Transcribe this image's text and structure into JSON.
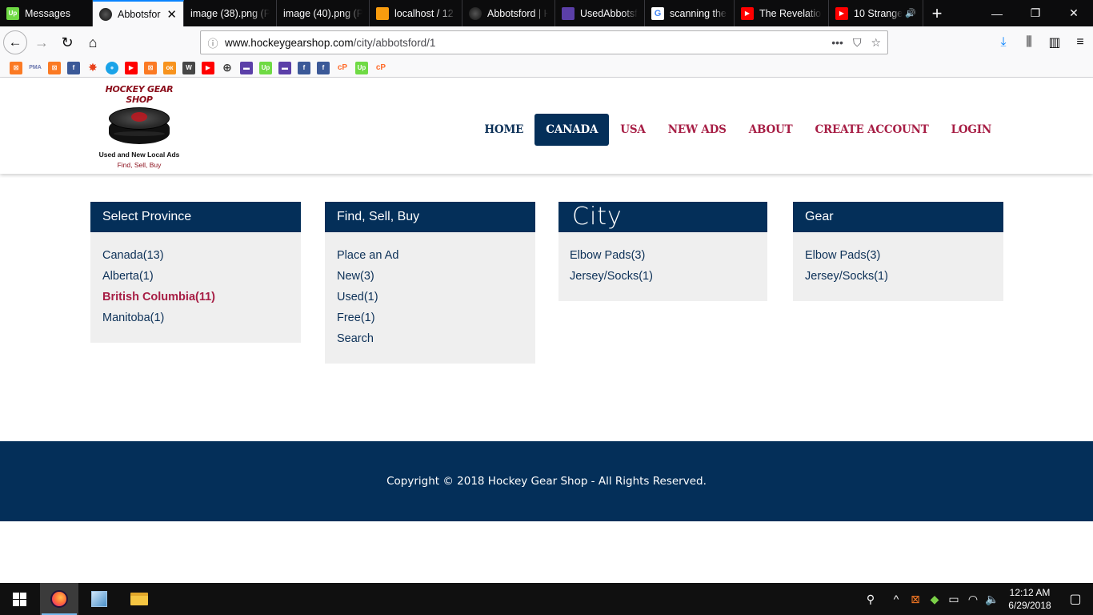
{
  "browser": {
    "tabs": [
      {
        "title": "Messages",
        "icon": "upwork-icon",
        "color": "#6fda44",
        "glyph": "Up",
        "active": false
      },
      {
        "title": "Abbotsfor",
        "icon": "puck-icon",
        "color": "#222222",
        "glyph": "",
        "active": true
      },
      {
        "title": "image (38).png (P",
        "icon": "",
        "color": "",
        "glyph": "",
        "active": false
      },
      {
        "title": "image (40).png (P",
        "icon": "",
        "color": "",
        "glyph": "",
        "active": false
      },
      {
        "title": "localhost / 12",
        "icon": "phpmyadmin-icon",
        "color": "#f89c0e",
        "glyph": "",
        "active": false
      },
      {
        "title": "Abbotsford | H",
        "icon": "puck-icon",
        "color": "#222222",
        "glyph": "",
        "active": false
      },
      {
        "title": "UsedAbbotsfo",
        "icon": "chat-icon",
        "color": "#5b3fa8",
        "glyph": "",
        "active": false
      },
      {
        "title": "scanning the p",
        "icon": "google-icon",
        "color": "#ffffff",
        "glyph": "G",
        "active": false
      },
      {
        "title": "The Revelatio",
        "icon": "youtube-icon",
        "color": "#ff0000",
        "glyph": "▶",
        "active": false
      },
      {
        "title": "10 Strange",
        "icon": "youtube-icon",
        "color": "#ff0000",
        "glyph": "▶",
        "active": false
      }
    ],
    "url_host": "www.hockeygearshop.com",
    "url_path": "/city/abbotsford/1",
    "bookmarks": [
      {
        "icon": "xampp-icon",
        "color": "#fb7a24",
        "glyph": "⊠"
      },
      {
        "icon": "phpmyadmin-icon",
        "color": "#f89c0e",
        "glyph": "PMA"
      },
      {
        "icon": "xampp-icon",
        "color": "#fb7a24",
        "glyph": "⊠"
      },
      {
        "icon": "facebook-icon",
        "color": "#3b5998",
        "glyph": "f"
      },
      {
        "icon": "burst-icon",
        "color": "#e8411b",
        "glyph": "✸"
      },
      {
        "icon": "globe-blue-icon",
        "color": "#1aa3e8",
        "glyph": "●"
      },
      {
        "icon": "youtube-icon",
        "color": "#ff0000",
        "glyph": "▶"
      },
      {
        "icon": "xampp-icon",
        "color": "#fb7a24",
        "glyph": "⊠"
      },
      {
        "icon": "odnoklassniki-icon",
        "color": "#f7931e",
        "glyph": "ок"
      },
      {
        "icon": "wordpress-icon",
        "color": "#464646",
        "glyph": "W"
      },
      {
        "icon": "youtube-icon",
        "color": "#ff0000",
        "glyph": "▶"
      },
      {
        "icon": "globe-icon",
        "color": "#333333",
        "glyph": "⊕"
      },
      {
        "icon": "chat-icon",
        "color": "#5b3fa8",
        "glyph": "▬"
      },
      {
        "icon": "upwork-icon",
        "color": "#6fda44",
        "glyph": "Up"
      },
      {
        "icon": "chat-icon",
        "color": "#5b3fa8",
        "glyph": "▬"
      },
      {
        "icon": "facebook-icon",
        "color": "#3b5998",
        "glyph": "f"
      },
      {
        "icon": "facebook-icon",
        "color": "#3b5998",
        "glyph": "f"
      },
      {
        "icon": "cpanel-icon",
        "color": "#ff6c2c",
        "glyph": "cP"
      },
      {
        "icon": "upwork-icon",
        "color": "#6fda44",
        "glyph": "Up"
      },
      {
        "icon": "cpanel-icon",
        "color": "#ff6c2c",
        "glyph": "cP"
      }
    ]
  },
  "site": {
    "logo": {
      "title": "HOCKEY GEAR SHOP",
      "line1": "Used and New Local Ads",
      "line2": "Find, Sell, Buy"
    },
    "nav": [
      {
        "label": "HOME",
        "active": false
      },
      {
        "label": "CANADA",
        "active": true
      },
      {
        "label": "USA",
        "active": false
      },
      {
        "label": "NEW ADS",
        "active": false
      },
      {
        "label": "ABOUT",
        "active": false
      },
      {
        "label": "CREATE ACCOUNT",
        "active": false
      },
      {
        "label": "LOGIN",
        "active": false
      }
    ],
    "boxes": [
      {
        "title": "Select Province",
        "items": [
          {
            "label": "Canada(13)",
            "selected": false
          },
          {
            "label": "Alberta(1)",
            "selected": false
          },
          {
            "label": "British Columbia(11)",
            "selected": true
          },
          {
            "label": "Manitoba(1)",
            "selected": false
          }
        ]
      },
      {
        "title": "Find, Sell, Buy",
        "items": [
          {
            "label": "Place an Ad",
            "selected": false
          },
          {
            "label": "New(3)",
            "selected": false
          },
          {
            "label": "Used(1)",
            "selected": false
          },
          {
            "label": "Free(1)",
            "selected": false
          },
          {
            "label": "Search",
            "selected": false
          }
        ]
      },
      {
        "title": "City",
        "items": [
          {
            "label": "Elbow Pads(3)",
            "selected": false
          },
          {
            "label": "Jersey/Socks(1)",
            "selected": false
          }
        ]
      },
      {
        "title": "Gear",
        "items": [
          {
            "label": "Elbow Pads(3)",
            "selected": false
          },
          {
            "label": "Jersey/Socks(1)",
            "selected": false
          }
        ]
      }
    ],
    "footer": "Copyright © 2018 Hockey Gear Shop - All Rights Reserved."
  },
  "taskbar": {
    "time": "12:12 AM",
    "date": "6/29/2018"
  },
  "colors": {
    "navy": "#042f59",
    "crimson": "#a71e45",
    "panel": "#efefef"
  }
}
